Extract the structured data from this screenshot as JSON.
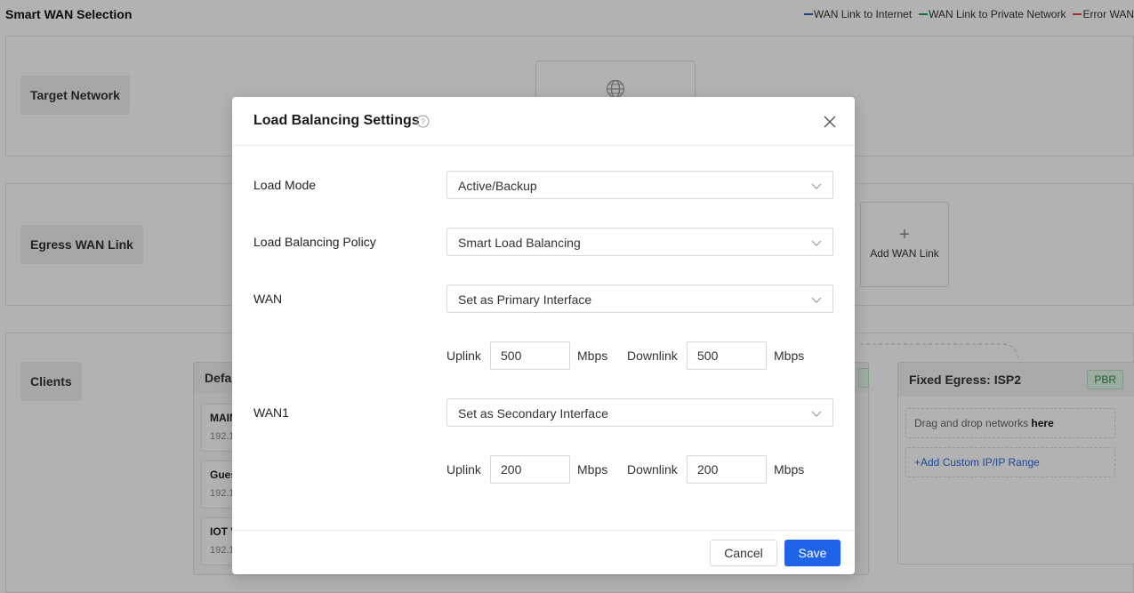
{
  "page": {
    "title": "Smart WAN Selection"
  },
  "legend": [
    {
      "label": "WAN Link to Internet",
      "color": "#2a5bd7"
    },
    {
      "label": "WAN Link to Private Network",
      "color": "#2e9e44"
    },
    {
      "label": "Error WAN",
      "color": "#e0463a"
    }
  ],
  "sections": {
    "target_network": "Target Network",
    "egress_wan_link": "Egress WAN Link",
    "clients": "Clients"
  },
  "egress": {
    "add_wan_link": "Add WAN Link"
  },
  "clients_area": {
    "default_title": "Defa",
    "networks": [
      {
        "name": "MAIN",
        "ip": "192.1"
      },
      {
        "name": "Gues",
        "ip": "192.1"
      },
      {
        "name": "IOT V",
        "ip": "192.1"
      }
    ],
    "fixed_egress": {
      "title": "Fixed Egress: ISP2",
      "badge": "PBR",
      "drop_text": "Drag and drop networks ",
      "drop_bold": "here",
      "add_link": "+Add Custom IP/IP Range"
    }
  },
  "modal": {
    "title": "Load Balancing Settings",
    "load_mode": {
      "label": "Load Mode",
      "value": "Active/Backup"
    },
    "policy": {
      "label": "Load Balancing Policy",
      "value": "Smart Load Balancing"
    },
    "wan": {
      "label": "WAN",
      "value": "Set as Primary Interface",
      "uplink_label": "Uplink",
      "uplink": "500",
      "downlink_label": "Downlink",
      "downlink": "500",
      "unit": "Mbps"
    },
    "wan1": {
      "label": "WAN1",
      "value": "Set as Secondary Interface",
      "uplink_label": "Uplink",
      "uplink": "200",
      "downlink_label": "Downlink",
      "downlink": "200",
      "unit": "Mbps"
    },
    "cancel": "Cancel",
    "save": "Save"
  },
  "colors": {
    "primary": "#1f63e8",
    "pbr_green": "#2e8b3e"
  }
}
